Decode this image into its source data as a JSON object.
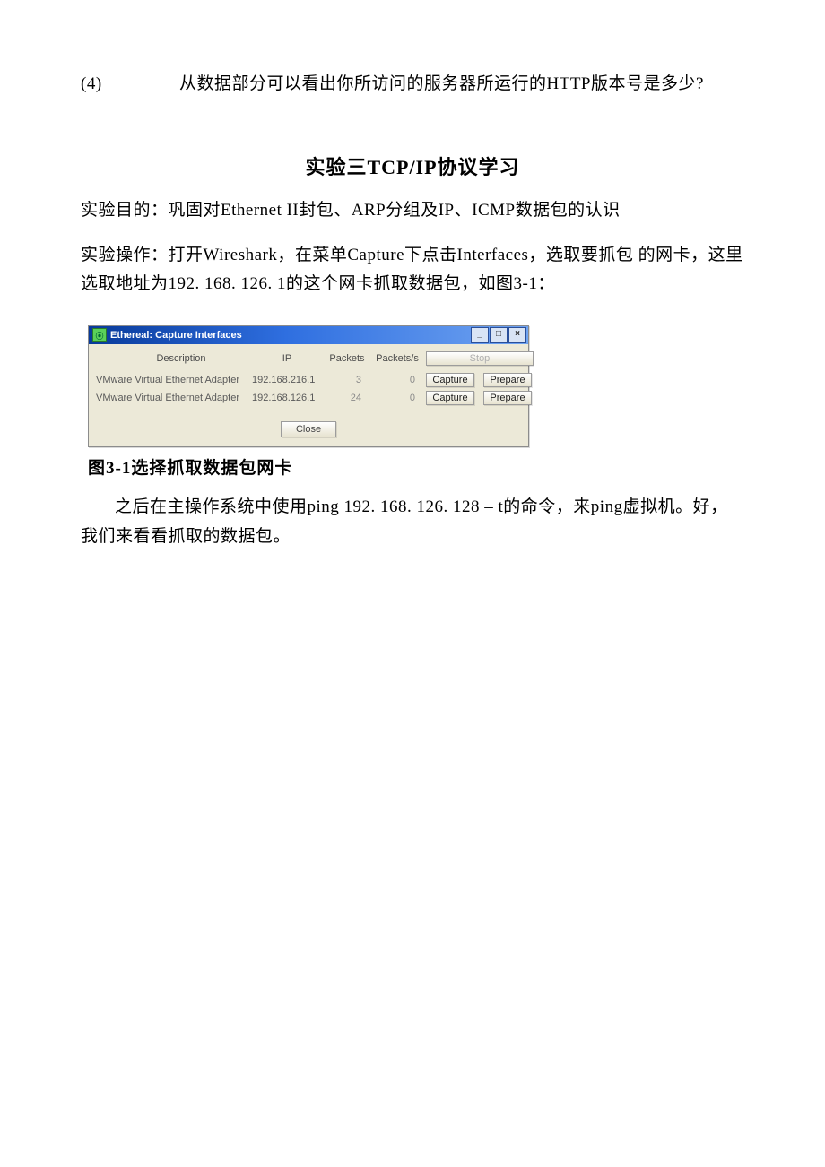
{
  "doc": {
    "q4_num": "(4)",
    "q4_text": "从数据部分可以看出你所访问的服务器所运行的HTTP版本号是多少?",
    "heading": "实验三TCP/IP协议学习",
    "para1": "实验目的：巩固对Ethernet II封包、ARP分组及IP、ICMP数据包的认识",
    "para2": "实验操作：打开Wireshark，在菜单Capture下点击Interfaces，选取要抓包 的网卡，这里选取地址为192. 168. 126. 1的这个网卡抓取数据包，如图3-1：",
    "caption": "图3-1选择抓取数据包网卡",
    "para3": "之后在主操作系统中使用ping 192. 168. 126. 128 – t的命令，来ping虚拟机。好，我们来看看抓取的数据包。"
  },
  "win": {
    "title": "Ethereal: Capture Interfaces",
    "min": "_",
    "max": "□",
    "close": "×",
    "cols": {
      "desc": "Description",
      "ip": "IP",
      "packets": "Packets",
      "pps": "Packets/s"
    },
    "stop": "Stop",
    "btn_capture": "Capture",
    "btn_prepare": "Prepare",
    "btn_close": "Close",
    "rows": [
      {
        "desc": "VMware Virtual Ethernet Adapter",
        "ip": "192.168.216.1",
        "packets": "3",
        "pps": "0"
      },
      {
        "desc": "VMware Virtual Ethernet Adapter",
        "ip": "192.168.126.1",
        "packets": "24",
        "pps": "0"
      }
    ]
  }
}
